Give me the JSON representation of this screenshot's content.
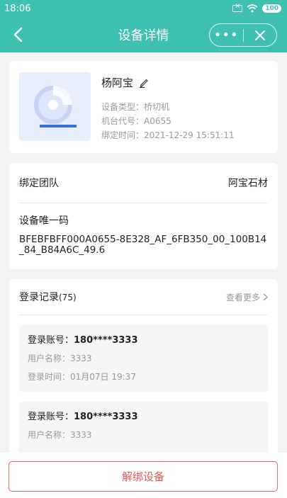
{
  "status": {
    "time": "18:06",
    "battery": "100"
  },
  "nav": {
    "title": "设备详情",
    "more": "•••"
  },
  "device": {
    "name": "杨阿宝",
    "type_label": "设备类型：",
    "type": "桥切机",
    "code_label": "机台代号：",
    "code": "A0655",
    "bind_time_label": "绑定时间：",
    "bind_time": "2021-12-29 15:51:11"
  },
  "team": {
    "label": "绑定团队",
    "value": "阿宝石材",
    "uid_label": "设备唯一码",
    "uid_value": "BFEBFBFF000A0655-8E328_AF_6FB350_00_100B14_84_B84A6C_49.6"
  },
  "login": {
    "title": "登录记录",
    "count": "(75)",
    "more": "查看更多",
    "records": [
      {
        "account_label": "登录账号：",
        "account": "180****3333",
        "user_label": "用户名称：",
        "user": "3333",
        "time_label": "登录时间：",
        "time": "01月07日 19:37"
      },
      {
        "account_label": "登录账号：",
        "account": "180****3333",
        "user_label": "用户名称：",
        "user": "3333"
      }
    ]
  },
  "action": {
    "unbind": "解绑设备"
  },
  "colors": {
    "primary": "#3fc1b0",
    "danger": "#e35a5a",
    "icon_blue": "#3b6fd8"
  }
}
